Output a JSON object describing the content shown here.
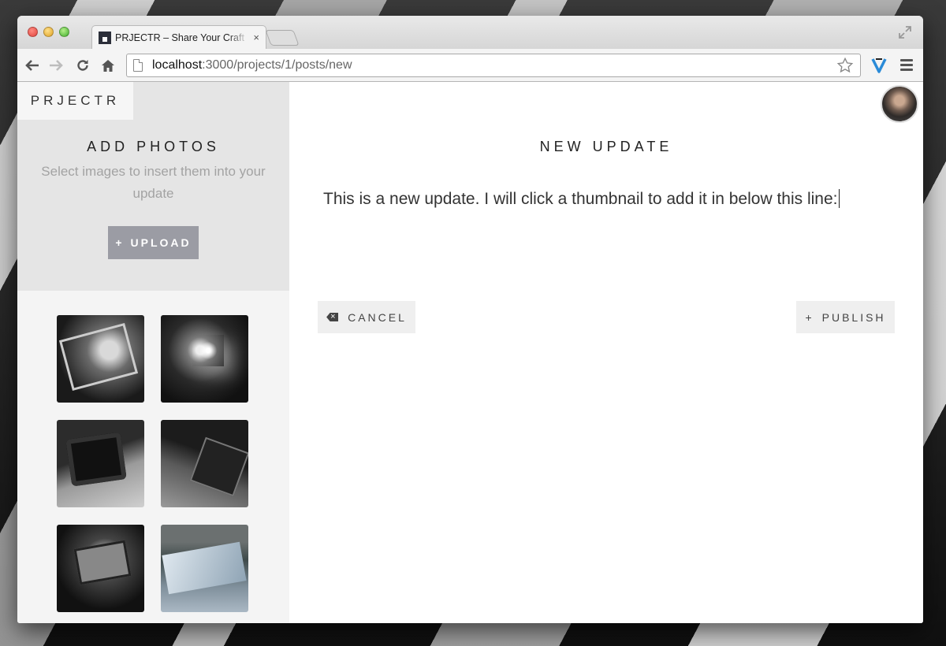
{
  "browser": {
    "tab_title": "PRJECTR – Share Your Craft",
    "tab_close": "×",
    "url_host": "localhost",
    "url_path": ":3000/projects/1/posts/new",
    "icons": [
      "back-arrow-icon",
      "forward-arrow-icon",
      "reload-icon",
      "home-icon",
      "page-icon",
      "star-icon",
      "extension-icon",
      "menu-icon",
      "fullscreen-icon"
    ]
  },
  "sidebar": {
    "logo": "PRJECTR",
    "title": "ADD PHOTOS",
    "subtitle": "Select images to insert them into your update",
    "upload_label": "UPLOAD",
    "upload_prefix": "+",
    "thumbnails": [
      "thumbnail-1",
      "thumbnail-2",
      "thumbnail-3",
      "thumbnail-4",
      "thumbnail-5",
      "thumbnail-6"
    ]
  },
  "main": {
    "title": "NEW UPDATE",
    "editor_text": "This is a new update. I will click a thumbnail to add it in below this line:",
    "cancel_label": "CANCEL",
    "publish_label": "PUBLISH",
    "publish_prefix": "+"
  },
  "colors": {
    "sidebar_bg": "#f4f4f4",
    "sidebar_top_bg": "#e5e5e5",
    "upload_button": "#9b9ca4",
    "action_button": "#efefef"
  }
}
